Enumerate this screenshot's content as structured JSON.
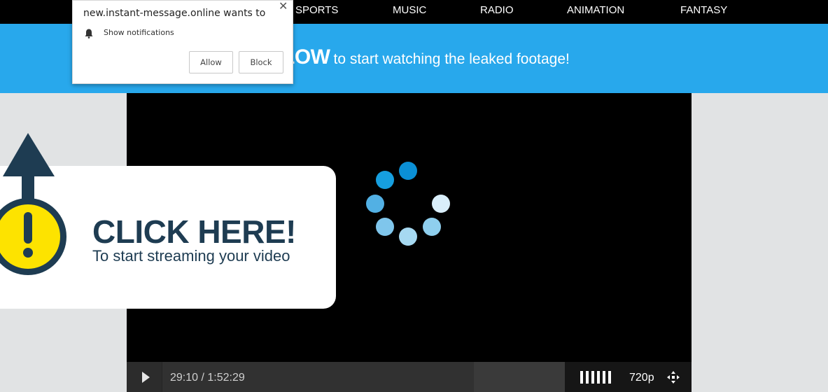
{
  "nav": {
    "items": [
      "SPORTS",
      "MUSIC",
      "RADIO",
      "ANIMATION",
      "FANTASY"
    ]
  },
  "banner": {
    "strong_text": "LOW",
    "rest_text": "to start watching the leaked footage!"
  },
  "player": {
    "time": "29:10 / 1:52:29",
    "quality": "720p",
    "spinner_colors": [
      "#0b90d6",
      "#169fdf",
      "#52b0e4",
      "#7fc6ec",
      "#8fcfee",
      "#a6d9f1",
      "#d9eefa"
    ]
  },
  "ad": {
    "title": "CLICK HERE!",
    "subtitle": "To start streaming your video"
  },
  "notification": {
    "site_text": "new.instant-message.online wants to",
    "permission": "Show notifications",
    "allow_label": "Allow",
    "block_label": "Block"
  },
  "colors": {
    "banner": "#28a8ec",
    "ad_text": "#1e3c52",
    "warning_yellow": "#fde300"
  },
  "icons": [
    "close-icon",
    "bell-icon",
    "play-icon",
    "volume-icon",
    "fullscreen-icon",
    "arrow-up-icon",
    "exclamation-icon",
    "loading-spinner-icon"
  ]
}
